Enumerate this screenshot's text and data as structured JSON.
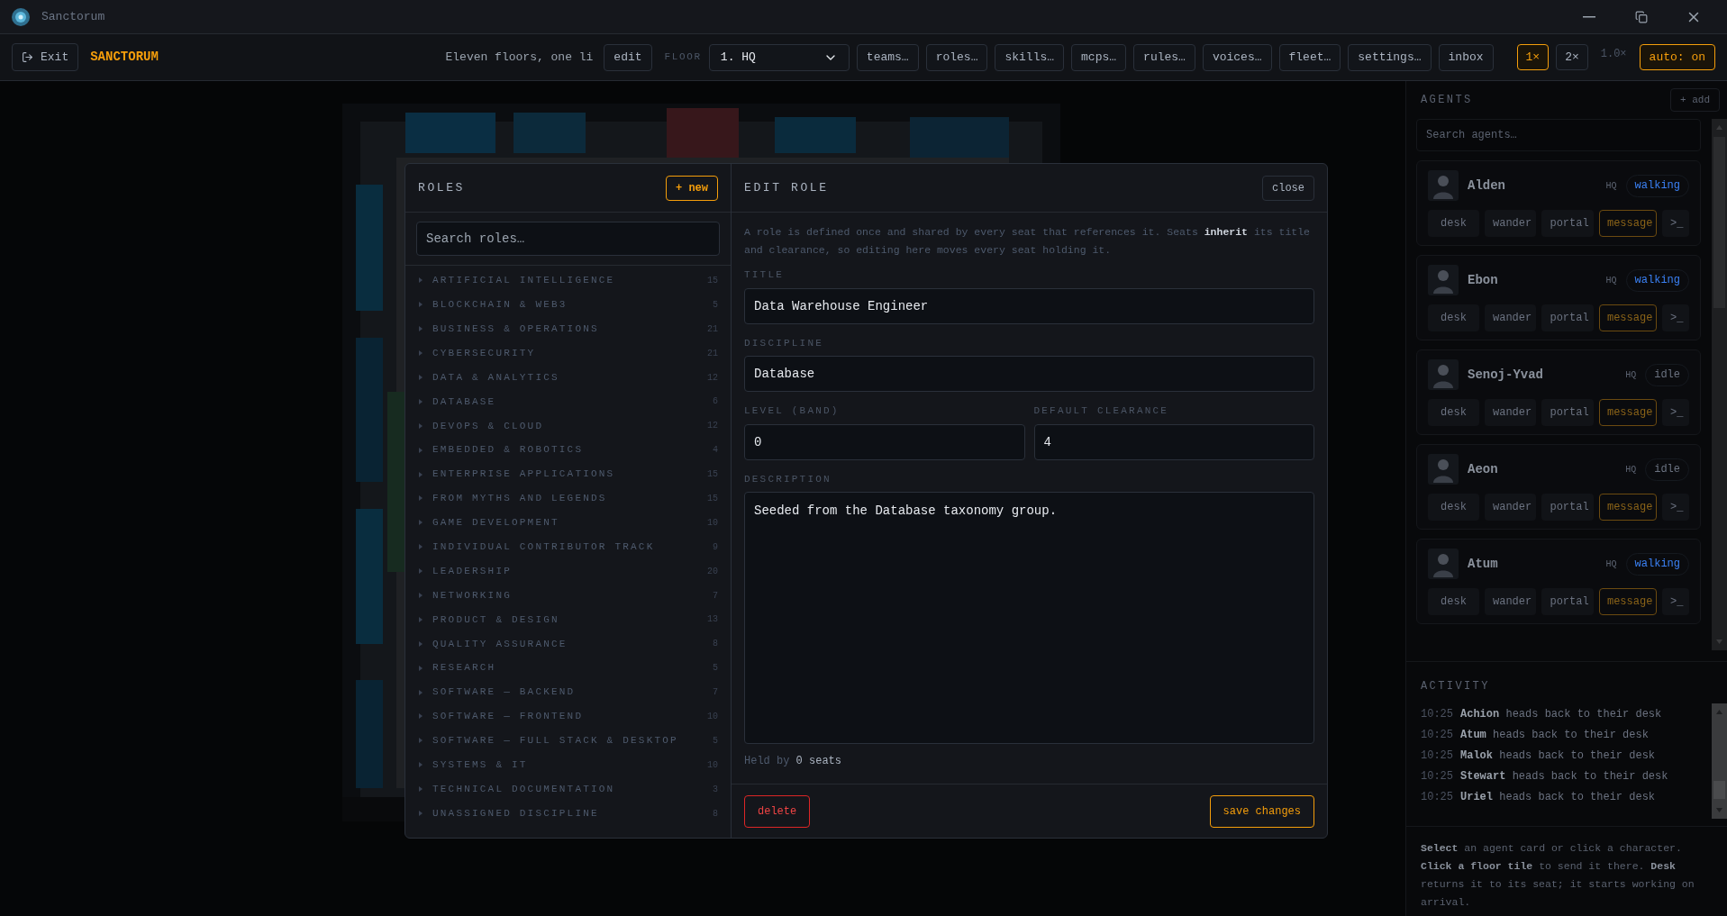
{
  "window": {
    "title": "Sanctorum"
  },
  "toolbar": {
    "exit": "Exit",
    "brand": "SANCTORUM",
    "tagline": "Eleven floors, one li",
    "edit": "edit",
    "floor_label": "FLOOR",
    "floor_value": "1. HQ",
    "buttons": [
      "teams…",
      "roles…",
      "skills…",
      "mcps…",
      "rules…",
      "voices…",
      "fleet…",
      "settings…",
      "inbox"
    ],
    "speeds": [
      {
        "label": "1×",
        "selected": true
      },
      {
        "label": "2×",
        "selected": false
      }
    ],
    "zoom_reading": "1.0×",
    "auto": {
      "label": "auto: on",
      "on": true
    }
  },
  "roles_modal": {
    "title": "ROLES",
    "new_button": "+ new",
    "search_placeholder": "Search roles…",
    "categories": [
      {
        "name": "ARTIFICIAL INTELLIGENCE",
        "count": "15",
        "expanded": false
      },
      {
        "name": "BLOCKCHAIN & WEB3",
        "count": "5",
        "expanded": false
      },
      {
        "name": "BUSINESS & OPERATIONS",
        "count": "21",
        "expanded": false
      },
      {
        "name": "CYBERSECURITY",
        "count": "21",
        "expanded": false
      },
      {
        "name": "DATA & ANALYTICS",
        "count": "12",
        "expanded": false
      },
      {
        "name": "DATABASE",
        "count": "6",
        "expanded": false
      },
      {
        "name": "DEVOPS & CLOUD",
        "count": "12",
        "expanded": false
      },
      {
        "name": "EMBEDDED & ROBOTICS",
        "count": "4",
        "expanded": false
      },
      {
        "name": "ENTERPRISE APPLICATIONS",
        "count": "15",
        "expanded": false
      },
      {
        "name": "FROM MYTHS AND LEGENDS",
        "count": "15",
        "expanded": false
      },
      {
        "name": "GAME DEVELOPMENT",
        "count": "10",
        "expanded": false
      },
      {
        "name": "INDIVIDUAL CONTRIBUTOR TRACK",
        "count": "9",
        "expanded": false
      },
      {
        "name": "LEADERSHIP",
        "count": "20",
        "expanded": false
      },
      {
        "name": "NETWORKING",
        "count": "7",
        "expanded": false
      },
      {
        "name": "PRODUCT & DESIGN",
        "count": "13",
        "expanded": false
      },
      {
        "name": "QUALITY ASSURANCE",
        "count": "8",
        "expanded": false
      },
      {
        "name": "RESEARCH",
        "count": "5",
        "expanded": false
      },
      {
        "name": "SOFTWARE — BACKEND",
        "count": "7",
        "expanded": false
      },
      {
        "name": "SOFTWARE — FRONTEND",
        "count": "10",
        "expanded": false
      },
      {
        "name": "SOFTWARE — FULL STACK & DESKTOP",
        "count": "5",
        "expanded": false
      },
      {
        "name": "SYSTEMS & IT",
        "count": "10",
        "expanded": false
      },
      {
        "name": "TECHNICAL DOCUMENTATION",
        "count": "3",
        "expanded": false
      },
      {
        "name": "UNASSIGNED DISCIPLINE",
        "count": "8",
        "expanded": false
      }
    ],
    "edit": {
      "title": "EDIT ROLE",
      "close": "close",
      "intro": "A role is defined once and shared by every seat that references it. Seats **inherit** its title and clearance, so editing here moves every seat holding it.",
      "title_label": "TITLE",
      "title_value": "Data Warehouse Engineer",
      "discipline_label": "DISCIPLINE",
      "discipline_value": "Database",
      "level_label": "LEVEL (BAND)",
      "level_value": "0",
      "clearance_label": "DEFAULT CLEARANCE",
      "clearance_value": "4",
      "description_label": "DESCRIPTION",
      "description_value": "Seeded from the Database taxonomy group.",
      "held_by": "Held by **0 seats**",
      "delete": "delete",
      "save": "save changes"
    }
  },
  "agents_panel": {
    "title": "AGENTS",
    "add": "+ add",
    "search_placeholder": "Search agents…",
    "agents": [
      {
        "name": "Alden",
        "floor": "HQ",
        "status": "walking",
        "color": "#3b82f6",
        "actions": [
          {
            "label": "desk",
            "accent": false
          },
          {
            "label": "wander",
            "accent": false
          },
          {
            "label": "portal",
            "accent": false
          },
          {
            "label": "message",
            "accent": true
          },
          {
            "label": ">_",
            "accent": false
          }
        ]
      },
      {
        "name": "Ebon",
        "floor": "HQ",
        "status": "walking",
        "color": "#3b82f6",
        "actions": [
          {
            "label": "desk",
            "accent": false
          },
          {
            "label": "wander",
            "accent": false
          },
          {
            "label": "portal",
            "accent": false
          },
          {
            "label": "message",
            "accent": true
          },
          {
            "label": ">_",
            "accent": false
          }
        ]
      },
      {
        "name": "Senoj-Yvad",
        "floor": "HQ",
        "status": "idle",
        "color": "#6b7280",
        "actions": [
          {
            "label": "desk",
            "accent": false
          },
          {
            "label": "wander",
            "accent": false
          },
          {
            "label": "portal",
            "accent": false
          },
          {
            "label": "message",
            "accent": true
          },
          {
            "label": ">_",
            "accent": false
          }
        ]
      },
      {
        "name": "Aeon",
        "floor": "HQ",
        "status": "idle",
        "color": "#6b7280",
        "actions": [
          {
            "label": "desk",
            "accent": false
          },
          {
            "label": "wander",
            "accent": false
          },
          {
            "label": "portal",
            "accent": false
          },
          {
            "label": "message",
            "accent": true
          },
          {
            "label": ">_",
            "accent": false
          }
        ]
      },
      {
        "name": "Atum",
        "floor": "HQ",
        "status": "walking",
        "color": "#3b82f6",
        "actions": [
          {
            "label": "desk",
            "accent": false
          },
          {
            "label": "wander",
            "accent": false
          },
          {
            "label": "portal",
            "accent": false
          },
          {
            "label": "message",
            "accent": true
          },
          {
            "label": ">_",
            "accent": false
          }
        ]
      }
    ]
  },
  "activity": {
    "title": "ACTIVITY",
    "entries": [
      {
        "time": "10:25",
        "text": "**Achion** heads back to their desk"
      },
      {
        "time": "10:25",
        "text": "**Atum** heads back to their desk"
      },
      {
        "time": "10:25",
        "text": "**Malok** heads back to their desk"
      },
      {
        "time": "10:25",
        "text": "**Stewart** heads back to their desk"
      },
      {
        "time": "10:25",
        "text": "**Uriel** heads back to their desk"
      }
    ]
  },
  "help": "**Select** an agent card or click a character. **Click a floor tile** to send it there. **Desk** returns it to its seat; it starts working on arrival."
}
